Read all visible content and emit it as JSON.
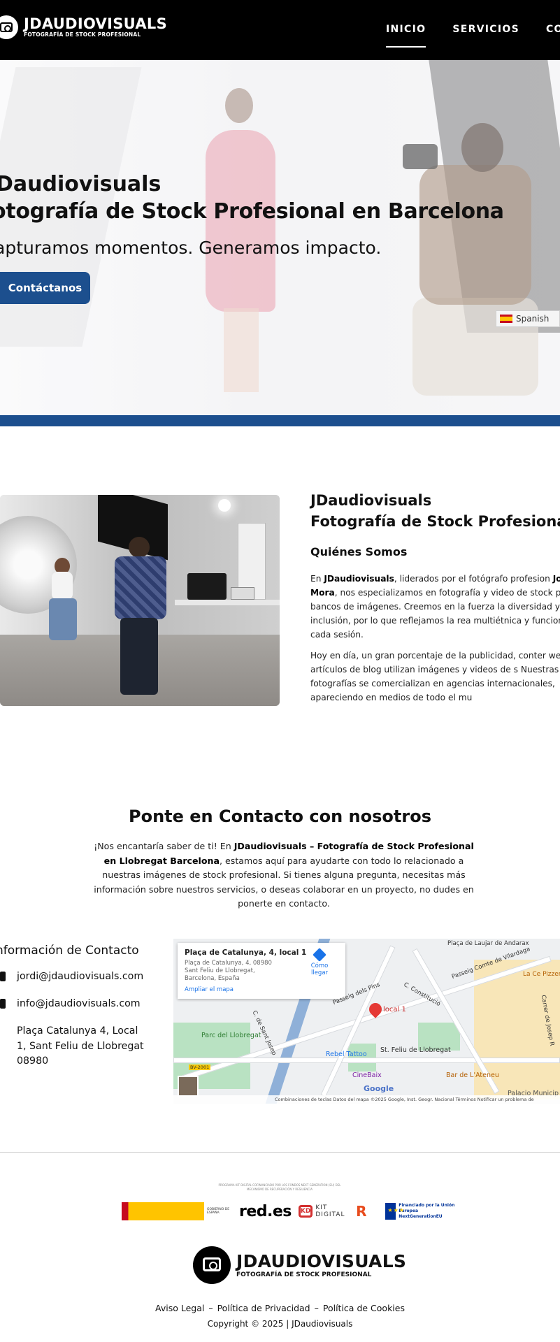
{
  "header": {
    "logo_title": "JDAUDIOVISUALS",
    "logo_subtitle": "FOTOGRAFÍA DE STOCK PROFESIONAL",
    "nav": [
      "INICIO",
      "SERVICIOS",
      "CONTA"
    ]
  },
  "hero": {
    "brand": "Daudiovisuals",
    "title": "otografía de Stock Profesional en Barcelona",
    "tagline": "apturamos momentos. Generamos impacto.",
    "cta": "Contáctanos",
    "language": "Spanish"
  },
  "about": {
    "brand": "JDaudiovisuals",
    "title": "Fotografía de Stock Profesiona",
    "subtitle": "Quiénes Somos",
    "p1_prefix": "En ",
    "p1_bold1": "JDaudiovisuals",
    "p1_mid": ", liderados por el fotógrafo profesion",
    "p1_bold2": "Jordi Mora",
    "p1_rest": ", nos especializamos en fotografía y video de stock para bancos de imágenes. Creemos en la fuerza la diversidad y la inclusión, por lo que reflejamos la rea multiétnica y funcional en cada sesión.",
    "p2": "Hoy en día, un gran porcentaje de la publicidad, conter web y artículos de blog utilizan imágenes y videos de s Nuestras fotografías se comercializan en agencias internacionales, apareciendo en medios de todo el mu"
  },
  "contact": {
    "heading": "Ponte en Contacto con nosotros",
    "intro_prefix": "¡Nos encantaría saber de ti! En ",
    "intro_bold": "JDaudiovisuals – Fotografía de Stock Profesional en Llobregat Barcelona",
    "intro_rest": ", estamos aquí para ayudarte con todo lo relacionado a nuestras imágenes de stock profesional. Si tienes alguna pregunta, necesitas más información sobre nuestros servicios, o deseas colaborar en un proyecto, no dudes en ponerte en contacto.",
    "info_heading": "nformación de Contacto",
    "email1": "jordi@jdaudiovisuals.com",
    "email2": "info@jdaudiovisuals.com",
    "address": "Plaça Catalunya 4, Local 1, Sant Feliu de Llobregat 08980"
  },
  "map": {
    "place_name": "Plaça de Catalunya, 4, local 1",
    "place_address": "Plaça de Catalunya, 4, 08980 Sant Feliu de Llobregat, Barcelona, España",
    "directions": "Cómo llegar",
    "enlarge": "Ampliar el mapa",
    "pin_label": "local 1",
    "labels": {
      "plaça": "Plaça de Laujar de Andarax",
      "villardaga": "Passeig Comte de Vilardaga",
      "pizzeria": "La Ce Pizzeria Bra",
      "constitucio": "C. Constitució",
      "pins": "Passeig dels Pins",
      "parc": "Parc del Llobregat",
      "sanjose": "C. de Sant Josep",
      "rebel": "Rebel Tattoo",
      "station": "St. Feliu de Llobregat",
      "cinebaix": "CineBaix",
      "ateneu": "Bar de L'Ateneu",
      "palacio": "Palacio Municip",
      "carrer": "Carrer de Josep R",
      "bv": "BV-2001"
    },
    "bottom_bar": "Combinaciones de teclas   Datos del mapa ©2025 Google, Inst. Geogr. Nacional   Términos   Notificar un problema de",
    "google": "Google"
  },
  "footer": {
    "funding_text": "PROGRAMA KIT DIGITAL COFINANCIADO POR LOS FONDOS NEXT GENERATION (EU) DEL MECANISMO DE RECUPERACIÓN Y RESILIENCIA",
    "gobierno": "GOBIERNO DE ESPAÑA",
    "redes": "red.es",
    "kit": "KIT DIGITAL",
    "eu": "Financiado por la Unión Europea NextGenerationEU",
    "logo_title": "JDAUDIOVISUALS",
    "logo_subtitle": "FOTOGRAFÍA DE STOCK PROFESIONAL",
    "links": [
      "Aviso Legal",
      "Política de Privacidad",
      "Política de Cookies"
    ],
    "copyright": "Copyright © 2025 | JDaudiovisuals"
  },
  "colors": {
    "brand_blue": "#1c4f8e",
    "header_bg": "#000000"
  }
}
